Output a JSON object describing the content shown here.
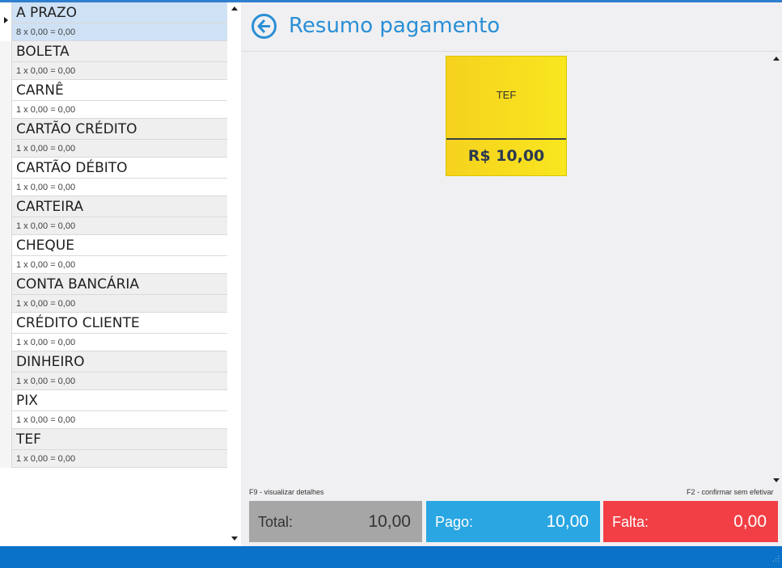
{
  "payment_methods": [
    {
      "name": "A PRAZO",
      "detail": "8 x 0,00 = 0,00",
      "selected": true
    },
    {
      "name": "BOLETA",
      "detail": "1 x 0,00 = 0,00"
    },
    {
      "name": "CARNÊ",
      "detail": "1 x 0,00 = 0,00"
    },
    {
      "name": "CARTÃO CRÉDITO",
      "detail": "1 x 0,00 = 0,00"
    },
    {
      "name": "CARTÃO DÉBITO",
      "detail": "1 x 0,00 = 0,00"
    },
    {
      "name": "CARTEIRA",
      "detail": "1 x 0,00 = 0,00"
    },
    {
      "name": "CHEQUE",
      "detail": "1 x 0,00 = 0,00"
    },
    {
      "name": "CONTA BANCÁRIA",
      "detail": "1 x 0,00 = 0,00"
    },
    {
      "name": "CRÉDITO CLIENTE",
      "detail": "1 x 0,00 = 0,00"
    },
    {
      "name": "DINHEIRO",
      "detail": "1 x 0,00 = 0,00"
    },
    {
      "name": "PIX",
      "detail": "1 x 0,00 = 0,00"
    },
    {
      "name": "TEF",
      "detail": "1 x 0,00 = 0,00"
    }
  ],
  "summary": {
    "title": "Resumo pagamento",
    "card": {
      "label": "TEF",
      "value": "R$ 10,00"
    }
  },
  "hints": {
    "details": "F9 - visualizar detalhes",
    "confirm": "F2 - confirmar sem efetivar"
  },
  "totals": {
    "total_label": "Total:",
    "total_value": "10,00",
    "pago_label": "Pago:",
    "pago_value": "10,00",
    "falta_label": "Falta:",
    "falta_value": "0,00"
  },
  "colors": {
    "accent": "#2a8fd6",
    "card_yellow": "#f6d21e",
    "pago": "#2aa6e3",
    "falta": "#f23f45",
    "total": "#a6a6a6",
    "statusbar": "#0a72c8"
  }
}
